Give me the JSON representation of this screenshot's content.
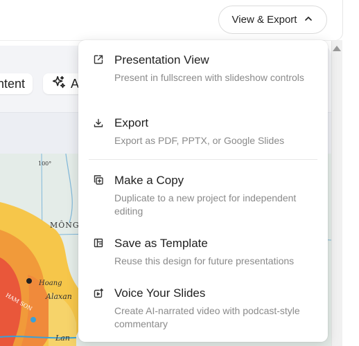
{
  "header": {
    "view_export_label": "View & Export"
  },
  "editor": {
    "content_pill_label": "ntent",
    "ai_pill_label": "A"
  },
  "map": {
    "labels": [
      "100°",
      "MÔNG",
      "Hoang",
      "Alaxan",
      "HAM SON",
      "Lan"
    ]
  },
  "menu": {
    "items": [
      {
        "icon": "external-link-icon",
        "title": "Presentation View",
        "description": "Present in fullscreen with slideshow controls"
      },
      {
        "icon": "download-icon",
        "title": "Export",
        "description": "Export as PDF, PPTX, or Google Slides"
      },
      {
        "icon": "copy-plus-icon",
        "title": "Make a Copy",
        "description": "Duplicate to a new project for independent editing"
      },
      {
        "icon": "template-layout-icon",
        "title": "Save as Template",
        "description": "Reuse this design for future presentations"
      },
      {
        "icon": "voice-video-icon",
        "title": "Voice Your Slides",
        "description": "Create AI-narrated video with podcast-style commentary"
      }
    ]
  }
}
